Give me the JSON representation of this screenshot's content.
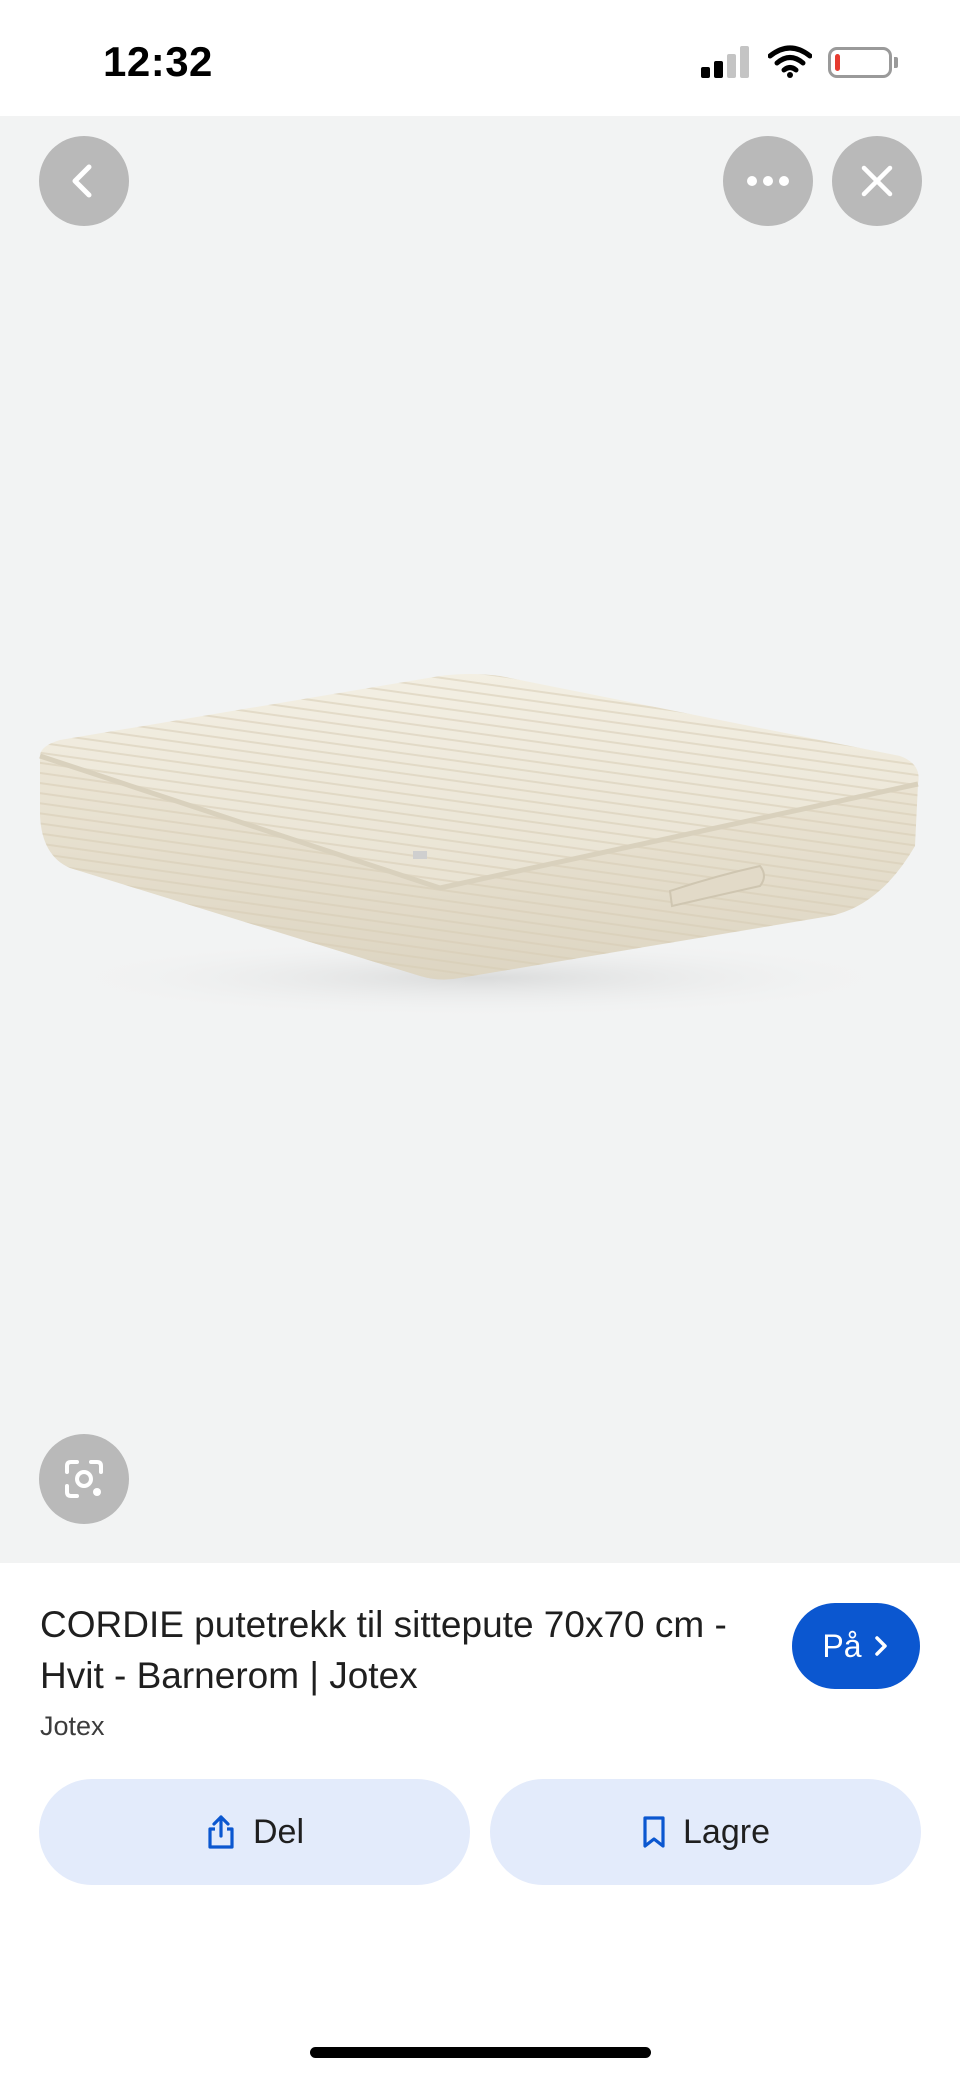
{
  "status_bar": {
    "time": "12:32",
    "battery_level": 0.1,
    "battery_color": "#e63b30",
    "signal_bars_active": 2,
    "signal_bars_total": 4
  },
  "viewer": {
    "background_color": "#f2f3f3",
    "icons": {
      "back": "chevron-left-icon",
      "more": "more-horizontal-icon",
      "close": "close-icon",
      "lens": "lens-camera-icon"
    }
  },
  "product": {
    "title": "CORDIE putetrekk til sittepute 70x70 cm - Hvit - Barnerom | Jotex",
    "source": "Jotex",
    "visit_label": "På",
    "accent_color": "#0b57d0"
  },
  "actions": {
    "share_label": "Del",
    "save_label": "Lagre",
    "button_color": "#e3ebfb"
  }
}
